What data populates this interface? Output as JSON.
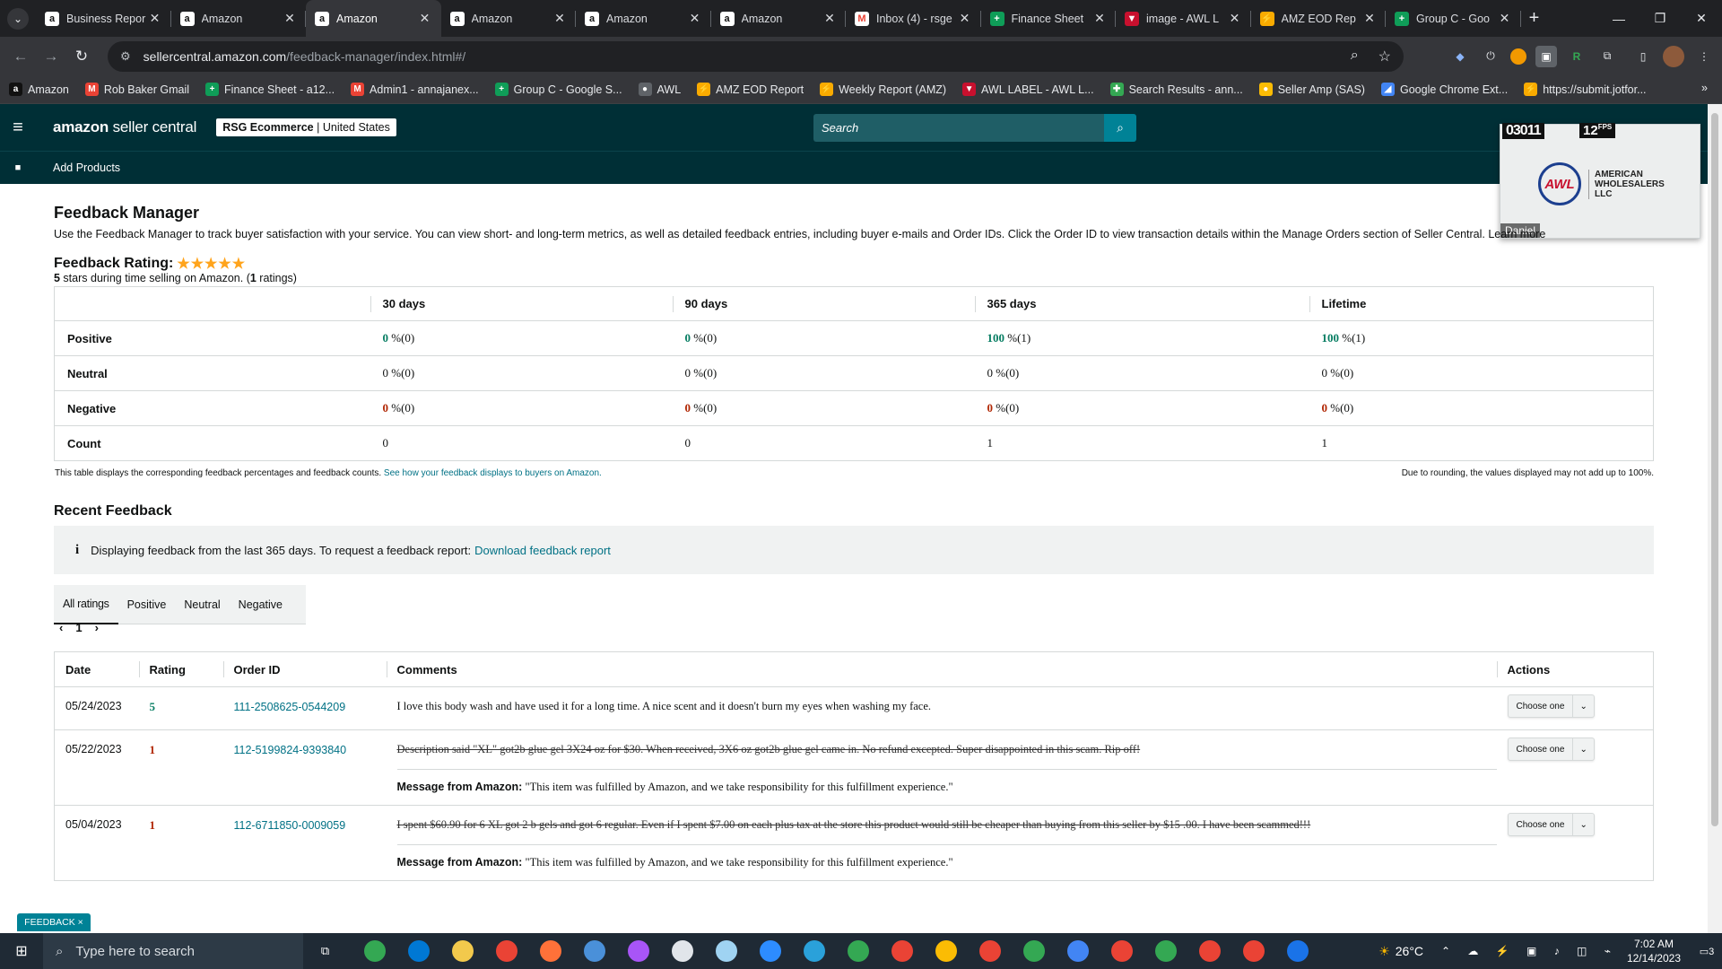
{
  "browser": {
    "tabs": [
      {
        "title": "Business Repor",
        "icon": "amazon",
        "active": false
      },
      {
        "title": "Amazon",
        "icon": "amazon",
        "active": false
      },
      {
        "title": "Amazon",
        "icon": "amazon",
        "active": true
      },
      {
        "title": "Amazon",
        "icon": "amazon",
        "active": false
      },
      {
        "title": "Amazon",
        "icon": "amazon",
        "active": false
      },
      {
        "title": "Amazon",
        "icon": "amazon",
        "active": false
      },
      {
        "title": "Inbox (4) - rsge",
        "icon": "gmail",
        "active": false
      },
      {
        "title": "Finance Sheet",
        "icon": "sheets",
        "active": false
      },
      {
        "title": "image - AWL L",
        "icon": "awl",
        "active": false
      },
      {
        "title": "AMZ EOD Rep",
        "icon": "amz-eod",
        "active": false
      },
      {
        "title": "Group C - Goo",
        "icon": "sheets",
        "active": false
      }
    ],
    "url_host": "sellercentral.amazon.com",
    "url_path": "/feedback-manager/index.html#/",
    "bookmarks": [
      {
        "label": "Amazon",
        "color": "#111111",
        "glyph": "a"
      },
      {
        "label": "Rob Baker Gmail",
        "color": "#ea4335",
        "glyph": "M"
      },
      {
        "label": "Finance Sheet - a12...",
        "color": "#0f9d58",
        "glyph": "+"
      },
      {
        "label": "Admin1 - annajanex...",
        "color": "#ea4335",
        "glyph": "M"
      },
      {
        "label": "Group C - Google S...",
        "color": "#0f9d58",
        "glyph": "+"
      },
      {
        "label": "AWL",
        "color": "#5f6368",
        "glyph": "●"
      },
      {
        "label": "AMZ EOD Report",
        "color": "#f9ab00",
        "glyph": "⚡"
      },
      {
        "label": "Weekly Report (AMZ)",
        "color": "#f9ab00",
        "glyph": "⚡"
      },
      {
        "label": "AWL LABEL - AWL L...",
        "color": "#c8102e",
        "glyph": "▼"
      },
      {
        "label": "Search Results - ann...",
        "color": "#34a853",
        "glyph": "✚"
      },
      {
        "label": "Seller Amp (SAS)",
        "color": "#fbbc04",
        "glyph": "●"
      },
      {
        "label": "Google Chrome Ext...",
        "color": "#4285f4",
        "glyph": "◢"
      },
      {
        "label": "https://submit.jotfor...",
        "color": "#f9ab00",
        "glyph": "⚡"
      }
    ]
  },
  "seller_central": {
    "logo_bold": "amazon",
    "logo_rest": " seller central",
    "store_bold": "RSG Ecommerce",
    "store_region": " | United States",
    "search_placeholder": "Search",
    "nav_link": "Add Products"
  },
  "overlay": {
    "frame": "03011",
    "fps": "12",
    "fps_unit": "FPS",
    "brand": "AWL",
    "brand_line1": "AMERICAN",
    "brand_line2": "WHOLESALERS",
    "brand_line3": "LLC",
    "presenter": "Daniel"
  },
  "page": {
    "title": "Feedback Manager",
    "intro": "Use the Feedback Manager to track buyer satisfaction with your service. You can view short- and long-term metrics, as well as detailed feedback entries, including buyer e-mails and Order IDs. Click the Order ID to view transaction details within the Manage Orders section of Seller Central. Learn more",
    "rating_label": "Feedback Rating:",
    "rating_stars": "★★★★★",
    "rating_sub_stars": "5",
    "rating_sub_mid": " stars during time selling on Amazon. (",
    "rating_sub_count": "1",
    "rating_sub_end": " ratings)"
  },
  "metrics": {
    "columns": [
      "30 days",
      "90 days",
      "365 days",
      "Lifetime"
    ],
    "rows": [
      {
        "label": "Positive",
        "kind": "pos",
        "cells": [
          {
            "v": "0",
            "n": " %(0)"
          },
          {
            "v": "0",
            "n": " %(0)"
          },
          {
            "v": "100",
            "n": " %(1)"
          },
          {
            "v": "100",
            "n": " %(1)"
          }
        ]
      },
      {
        "label": "Neutral",
        "kind": "neu",
        "cells": [
          {
            "v": "0",
            "n": " %(0)"
          },
          {
            "v": "0",
            "n": " %(0)"
          },
          {
            "v": "0",
            "n": " %(0)"
          },
          {
            "v": "0",
            "n": " %(0)"
          }
        ]
      },
      {
        "label": "Negative",
        "kind": "neg",
        "cells": [
          {
            "v": "0",
            "n": " %(0)"
          },
          {
            "v": "0",
            "n": " %(0)"
          },
          {
            "v": "0",
            "n": " %(0)"
          },
          {
            "v": "0",
            "n": " %(0)"
          }
        ]
      },
      {
        "label": "Count",
        "kind": "cnt",
        "cells": [
          {
            "v": "0",
            "n": ""
          },
          {
            "v": "0",
            "n": ""
          },
          {
            "v": "1",
            "n": ""
          },
          {
            "v": "1",
            "n": ""
          }
        ]
      }
    ],
    "note": "This table displays the corresponding feedback percentages and feedback counts.",
    "note_link": "See how your feedback displays to buyers on Amazon.",
    "note_right": "Due to rounding, the values displayed may not add up to 100%."
  },
  "recent": {
    "title": "Recent Feedback",
    "info_icon": "i",
    "info_text": "Displaying feedback from the last 365 days. To request a feedback report:",
    "info_link": "Download feedback report",
    "tabs": [
      "All ratings",
      "Positive",
      "Neutral",
      "Negative"
    ],
    "page": "1",
    "columns": {
      "date": "Date",
      "rating": "Rating",
      "order": "Order ID",
      "comments": "Comments",
      "actions": "Actions"
    },
    "rows": [
      {
        "date": "05/24/2023",
        "rating": "5",
        "rating_kind": "pos",
        "order": "111-2508625-0544209",
        "comment": "I love this body wash and have used it for a long time. A nice scent and it doesn't burn my eyes when washing my face.",
        "struck": false,
        "message_label": "",
        "message": "",
        "action": "Choose one"
      },
      {
        "date": "05/22/2023",
        "rating": "1",
        "rating_kind": "neg",
        "order": "112-5199824-9393840",
        "comment": "Description said \"XL\" got2b glue gel 3X24 oz for $30. When received, 3X6 oz got2b glue gel came in. No refund excepted. Super disappointed in this scam. Rip off!",
        "struck": true,
        "message_label": "Message from Amazon:",
        "message": " \"This item was fulfilled by Amazon, and we take responsibility for this fulfillment experience.\"",
        "action": "Choose one"
      },
      {
        "date": "05/04/2023",
        "rating": "1",
        "rating_kind": "neg",
        "order": "112-6711850-0009059",
        "comment": "I spent $60.90 for 6 XL got 2 b gels and got 6 regular. Even if I spent $7.00 on each plus tax at the store this product would still be cheaper than buying from this seller by $15 .00. I have been scammed!!!",
        "struck": true,
        "message_label": "Message from Amazon:",
        "message": " \"This item was fulfilled by Amazon, and we take responsibility for this fulfillment experience.\"",
        "action": "Choose one"
      }
    ]
  },
  "feedback_tab": "FEEDBACK ×",
  "taskbar": {
    "search_placeholder": "Type here to search",
    "weather": "26°C",
    "time": "7:02 AM",
    "date": "12/14/2023",
    "notif_count": "3",
    "apps": [
      {
        "name": "chrome",
        "color": "#34a853"
      },
      {
        "name": "mail",
        "color": "#0078d4"
      },
      {
        "name": "file-explorer",
        "color": "#f2c94c"
      },
      {
        "name": "chrome-alt",
        "color": "#ea4335"
      },
      {
        "name": "firefox",
        "color": "#ff7139"
      },
      {
        "name": "calculator",
        "color": "#4a90d9"
      },
      {
        "name": "wps",
        "color": "#a855f7"
      },
      {
        "name": "snipping",
        "color": "#e1e5ea"
      },
      {
        "name": "notepad",
        "color": "#9fd3f2"
      },
      {
        "name": "zoom",
        "color": "#2d8cff"
      },
      {
        "name": "telegram",
        "color": "#2aa1da"
      },
      {
        "name": "chrome-2",
        "color": "#34a853"
      },
      {
        "name": "chrome-3",
        "color": "#ea4335"
      },
      {
        "name": "chrome-4",
        "color": "#fbbc04"
      },
      {
        "name": "chrome-5",
        "color": "#ea4335"
      },
      {
        "name": "chrome-6",
        "color": "#34a853"
      },
      {
        "name": "chrome-7",
        "color": "#4285f4"
      },
      {
        "name": "chrome-8",
        "color": "#ea4335"
      },
      {
        "name": "chrome-9",
        "color": "#34a853"
      },
      {
        "name": "chrome-10",
        "color": "#ea4335"
      },
      {
        "name": "chrome-11",
        "color": "#ea4335"
      },
      {
        "name": "r-app",
        "color": "#1a73e8"
      }
    ]
  }
}
